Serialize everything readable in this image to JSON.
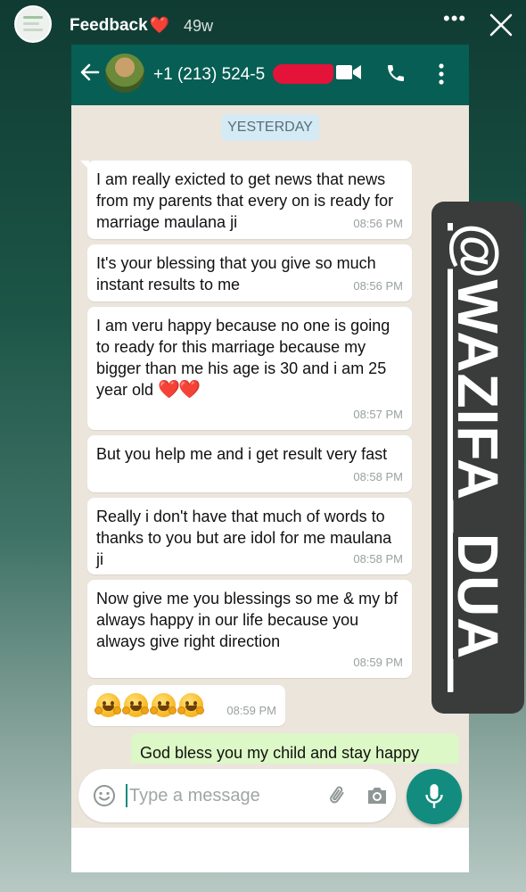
{
  "story": {
    "username": "Feedback",
    "heart": "❤️",
    "posted_ago": "49w",
    "more_icon": "more-horizontal-icon",
    "close_icon": "close-icon"
  },
  "chat_header": {
    "back_icon": "back-arrow-icon",
    "contact_number": "+1 (213) 524-5",
    "number_redacted": true,
    "video_call_icon": "video-call-icon",
    "voice_call_icon": "phone-icon",
    "menu_icon": "more-vertical-icon",
    "color": "#075e54"
  },
  "chat": {
    "date_label": "YESTERDAY",
    "incoming": [
      {
        "text": "I am really exicted to get news that news from my parents that every on is ready for marriage maulana ji",
        "time": "08:56 PM"
      },
      {
        "text": "It's your blessing that you give so much instant results to me",
        "time": "08:56 PM"
      },
      {
        "text": "I am veru happy because no one is going to ready for this marriage because my bigger than me his age is 30 and i am 25 year old",
        "hearts": "❤️❤️",
        "time": "08:57 PM"
      },
      {
        "text": "But you help me and i get result very fast",
        "time": "08:58 PM"
      },
      {
        "text": "Really i don't have that much of words to thanks to you but are idol for me maulana ji",
        "time": "08:58 PM"
      },
      {
        "text": "Now give me you blessings so me & my bf always happy in our life because you always give right direction",
        "time": "08:59 PM"
      },
      {
        "emoji": "🤗🤗🤗🤗",
        "time": "08:59 PM"
      }
    ],
    "outgoing": [
      {
        "text": "God bless you my child and stay happy"
      }
    ]
  },
  "composer": {
    "placeholder": "Type a message",
    "emoji_icon": "emoji-icon",
    "attach_icon": "paperclip-icon",
    "camera_icon": "camera-icon",
    "mic_icon": "microphone-icon",
    "accent": "#128c7e"
  },
  "watermark": {
    "text": "@WAZIFA_DUA_"
  }
}
